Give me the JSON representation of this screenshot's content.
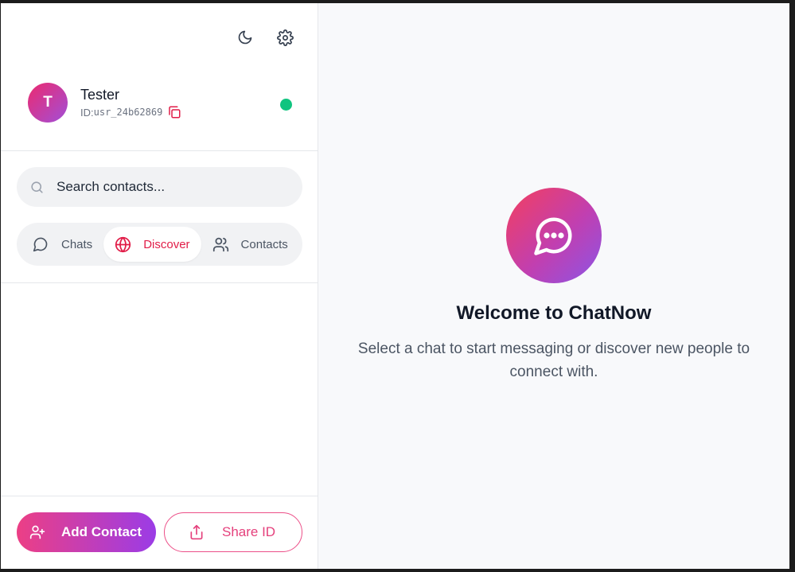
{
  "user": {
    "initial": "T",
    "name": "Tester",
    "id_prefix": "ID:",
    "id": "usr_24b62869",
    "status_color": "#10c47f"
  },
  "search": {
    "placeholder": "Search contacts..."
  },
  "tabs": [
    {
      "label": "Chats",
      "icon": "chat-bubble-icon",
      "active": false
    },
    {
      "label": "Discover",
      "icon": "globe-icon",
      "active": true
    },
    {
      "label": "Contacts",
      "icon": "users-icon",
      "active": false
    }
  ],
  "actions": {
    "add_contact": "Add Contact",
    "share_id": "Share ID"
  },
  "welcome": {
    "title": "Welcome to ChatNow",
    "text": "Select a chat to start messaging or discover new people to connect with."
  },
  "colors": {
    "accent": "#e11d48",
    "gradient_start": "#ec3f85",
    "gradient_end": "#9b3ce6"
  }
}
